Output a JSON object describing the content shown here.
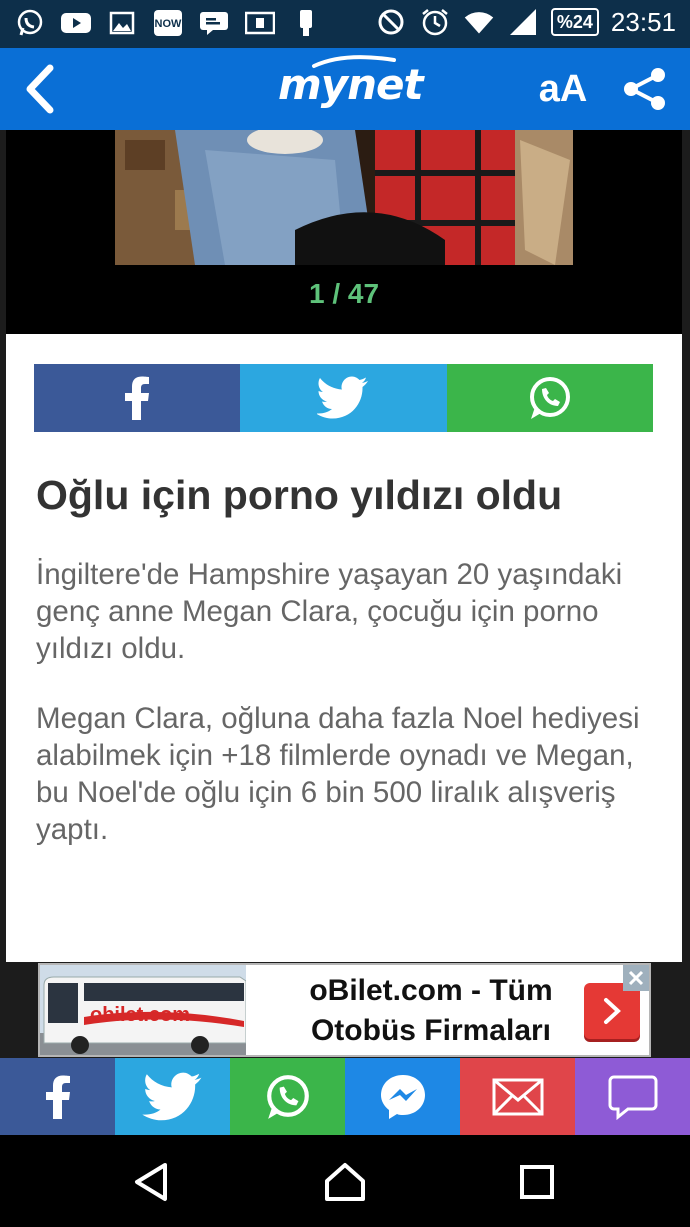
{
  "status_bar": {
    "icons_left": [
      "whatsapp-icon",
      "youtube-icon",
      "image-icon",
      "now-icon",
      "message-icon",
      "card-icon",
      "phone-icon"
    ],
    "icons_right": [
      "do-not-disturb-icon",
      "alarm-icon",
      "wifi-icon",
      "signal-icon"
    ],
    "battery": "%24",
    "time": "23:51"
  },
  "app_bar": {
    "logo": "mynet",
    "font_size_label": "aA"
  },
  "gallery": {
    "counter": "1 / 47"
  },
  "article": {
    "headline": "Oğlu için porno yıldızı oldu",
    "paragraphs": [
      "İngiltere'de Hampshire yaşayan 20 yaşındaki genç anne Megan Clara, çocuğu için porno yıldızı oldu.",
      "Megan Clara, oğluna daha fazla Noel hediyesi alabilmek için +18 filmlerde oynadı ve Megan, bu Noel'de oğlu için 6 bin 500 liralık alışveriş yaptı."
    ]
  },
  "ad": {
    "bus_brand": "obilet.com",
    "line1": "oBilet.com - Tüm",
    "line2": "Otobüs Firmaları"
  },
  "colors": {
    "status_bar": "#0d2f4a",
    "app_bar": "#0a6fd6",
    "facebook": "#3b5998",
    "twitter": "#2ca7e0",
    "whatsapp": "#3bb54a",
    "messenger": "#1e88e5",
    "mail": "#e0454a",
    "comment": "#8e5bd6",
    "counter": "#5ec27a"
  }
}
